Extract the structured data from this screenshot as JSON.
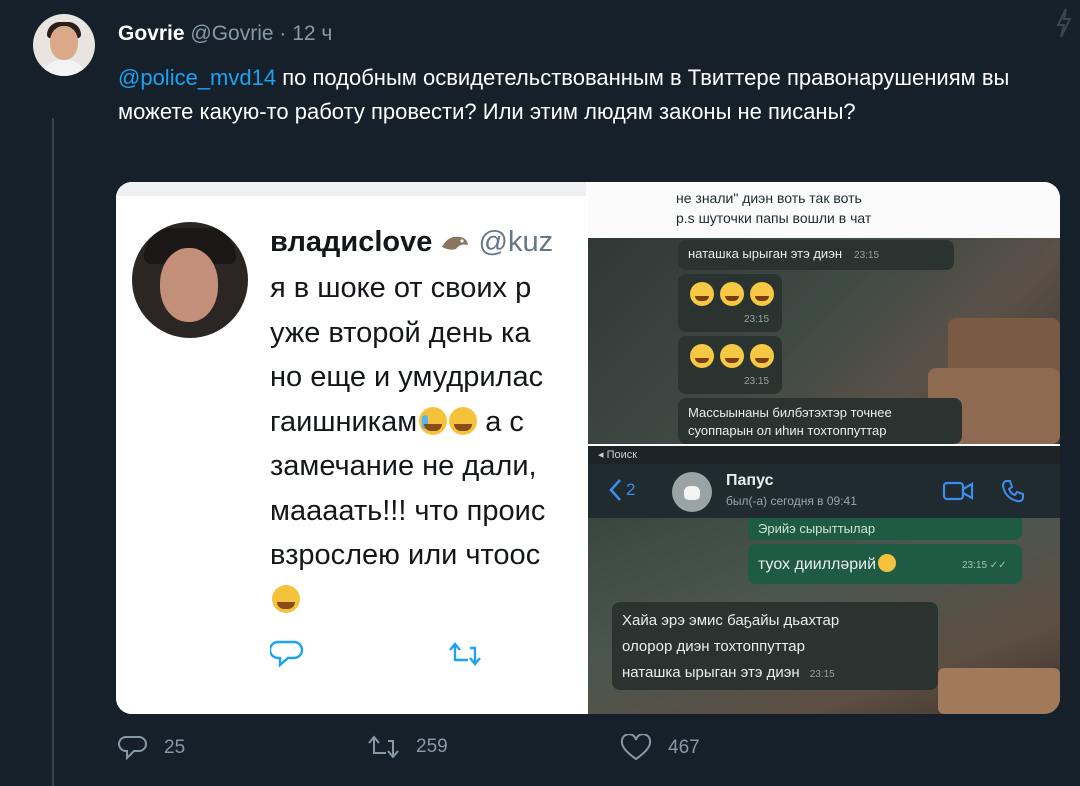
{
  "tweet": {
    "author_name": "Govrie",
    "author_handle": "@Govrie",
    "separator": " · ",
    "time": "12 ч",
    "mention": "@police_mvd14",
    "body": " по подобным освидетельствованным в Твиттере правонарушениям вы можете какую-то работу провести? Или этим людям законы не писаны?",
    "stats": {
      "replies": "25",
      "retweets": "259",
      "likes": "467"
    }
  },
  "embedded_tweet": {
    "name": "владиclove",
    "handle": "@kuz",
    "lines": [
      "я в шоке от своих р",
      "уже второй день ка",
      "но еще и умудрилас",
      "гаишникам",
      "замечание не дали,",
      "маааать!!! что проис",
      "взрослею или чтоос"
    ],
    "line4_after_emoji": " а с"
  },
  "chat_top": {
    "line1": "не знали\" диэн воть так воть",
    "line2": "p.s шуточки папы вошли в чат",
    "msg1": "наташка ырыган этэ диэн",
    "msg1_time": "23:15",
    "msg2_time": "23:15",
    "msg3_time": "23:15",
    "msg4_line1": "Массыынаны билбэтэхтэр точнее",
    "msg4_line2": "суоппарын ол иһин тохтоппуттар"
  },
  "chat_bottom": {
    "status_bar": "◂ Поиск",
    "back_count": "2",
    "contact_name": "Папус",
    "contact_status": "был(-а) сегодня в 09:41",
    "out1": "Эрийэ сырыттылар",
    "out2": "туох диилләрий",
    "out2_time": "23:15 ✓✓",
    "in_line1": "Хайа эрэ эмис баҕайы дьахтар",
    "in_line2": "олорор диэн тохтоппуттар",
    "in_line3": "наташка ырыган этэ диэн",
    "in_time": "23:15"
  },
  "colors": {
    "background": "#15202b",
    "link": "#1da1f2",
    "muted": "#8899a6"
  },
  "icons": [
    "bolt-icon",
    "reply-icon",
    "retweet-icon",
    "like-icon",
    "bird-icon",
    "back-icon",
    "video-icon",
    "phone-icon"
  ]
}
